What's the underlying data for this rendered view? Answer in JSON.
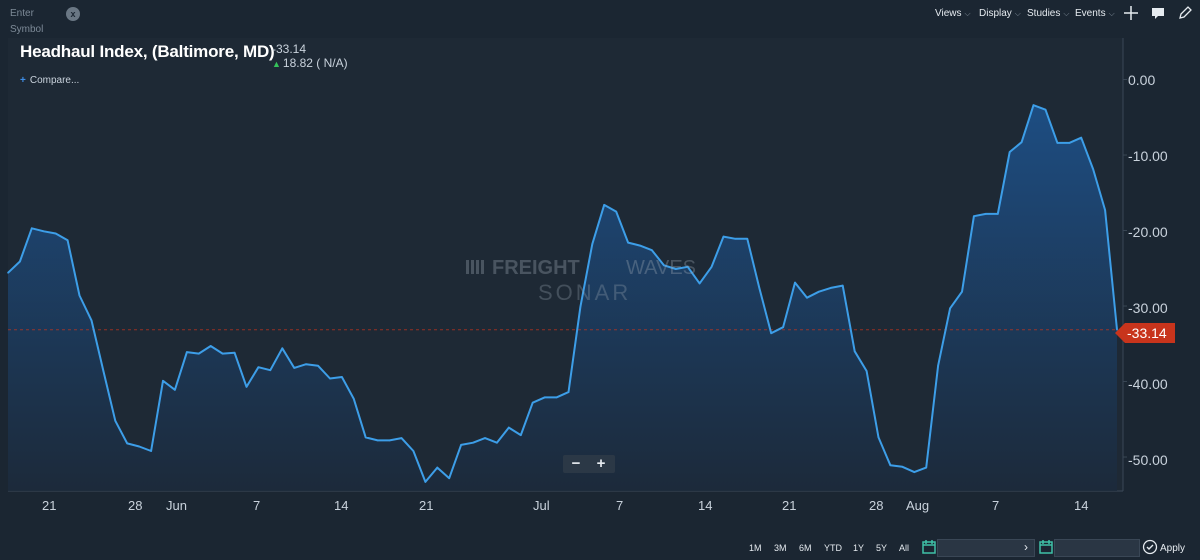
{
  "toolbar": {
    "symbol_placeholder": "Enter Symbol",
    "clear_label": "x",
    "menus": [
      "Views",
      "Display",
      "Studies",
      "Events"
    ]
  },
  "header": {
    "title": "Headhaul Index, (Baltimore, MD)",
    "last_value": "-33.14",
    "change_value": "18.82 ( N/A)",
    "compare_label": "Compare..."
  },
  "watermark": {
    "line1a": "FREIGHT",
    "line1b": "WAVES",
    "line2": "SONAR"
  },
  "price_tag": "-33.14",
  "zoom": {
    "out": "−",
    "in": "+"
  },
  "range_buttons": [
    "1M",
    "3M",
    "6M",
    "YTD",
    "1Y",
    "5Y",
    "All"
  ],
  "apply_label": "Apply",
  "colors": {
    "line": "#3d9ee8",
    "fill_top": "#1d4f86",
    "fill_bottom": "#1c2a3b",
    "price_tag": "#c8341c",
    "up_arrow": "#35c35a"
  },
  "chart_data": {
    "type": "area",
    "title": "Headhaul Index, (Baltimore, MD)",
    "ylim": [
      -54.5,
      5.5
    ],
    "y_ticks": [
      "0.00",
      "-10.00",
      "-20.00",
      "-30.00",
      "-40.00",
      "-50.00"
    ],
    "x_tick_labels": [
      "21",
      "28",
      "Jun",
      "7",
      "14",
      "21",
      "Jul",
      "7",
      "14",
      "21",
      "28",
      "Aug",
      "7",
      "14"
    ],
    "last_value": -33.14,
    "grid": false,
    "series": [
      {
        "values": [
          -25.6,
          -24.1,
          -19.7,
          -20.1,
          -20.4,
          -21.3,
          -28.6,
          -31.9,
          -38.6,
          -45.2,
          -48.2,
          -48.6,
          -49.2,
          -39.9,
          -41.1,
          -36.1,
          -36.3,
          -35.3,
          -36.3,
          -36.2,
          -40.7,
          -38.1,
          -38.5,
          -35.6,
          -38.2,
          -37.7,
          -37.9,
          -39.6,
          -39.4,
          -42.3,
          -47.4,
          -47.8,
          -47.8,
          -47.5,
          -49.2,
          -53.3,
          -51.4,
          -52.8,
          -48.4,
          -48.1,
          -47.5,
          -48.1,
          -46.1,
          -47.1,
          -42.8,
          -42.1,
          -42.1,
          -41.4,
          -30.1,
          -21.8,
          -16.6,
          -17.5,
          -21.6,
          -22.0,
          -22.6,
          -24.6,
          -25.1,
          -24.8,
          -27.0,
          -24.8,
          -20.8,
          -21.1,
          -21.1,
          -27.6,
          -33.6,
          -32.8,
          -26.9,
          -28.9,
          -28.1,
          -27.6,
          -27.3,
          -36.0,
          -38.6,
          -47.4,
          -51.1,
          -51.3,
          -52.0,
          -51.4,
          -37.9,
          -30.3,
          -28.1,
          -18.1,
          -17.8,
          -17.8,
          -9.6,
          -8.3,
          -3.4,
          -4.0,
          -8.4,
          -8.4,
          -7.7,
          -11.9,
          -17.3,
          -33.14
        ]
      }
    ]
  }
}
